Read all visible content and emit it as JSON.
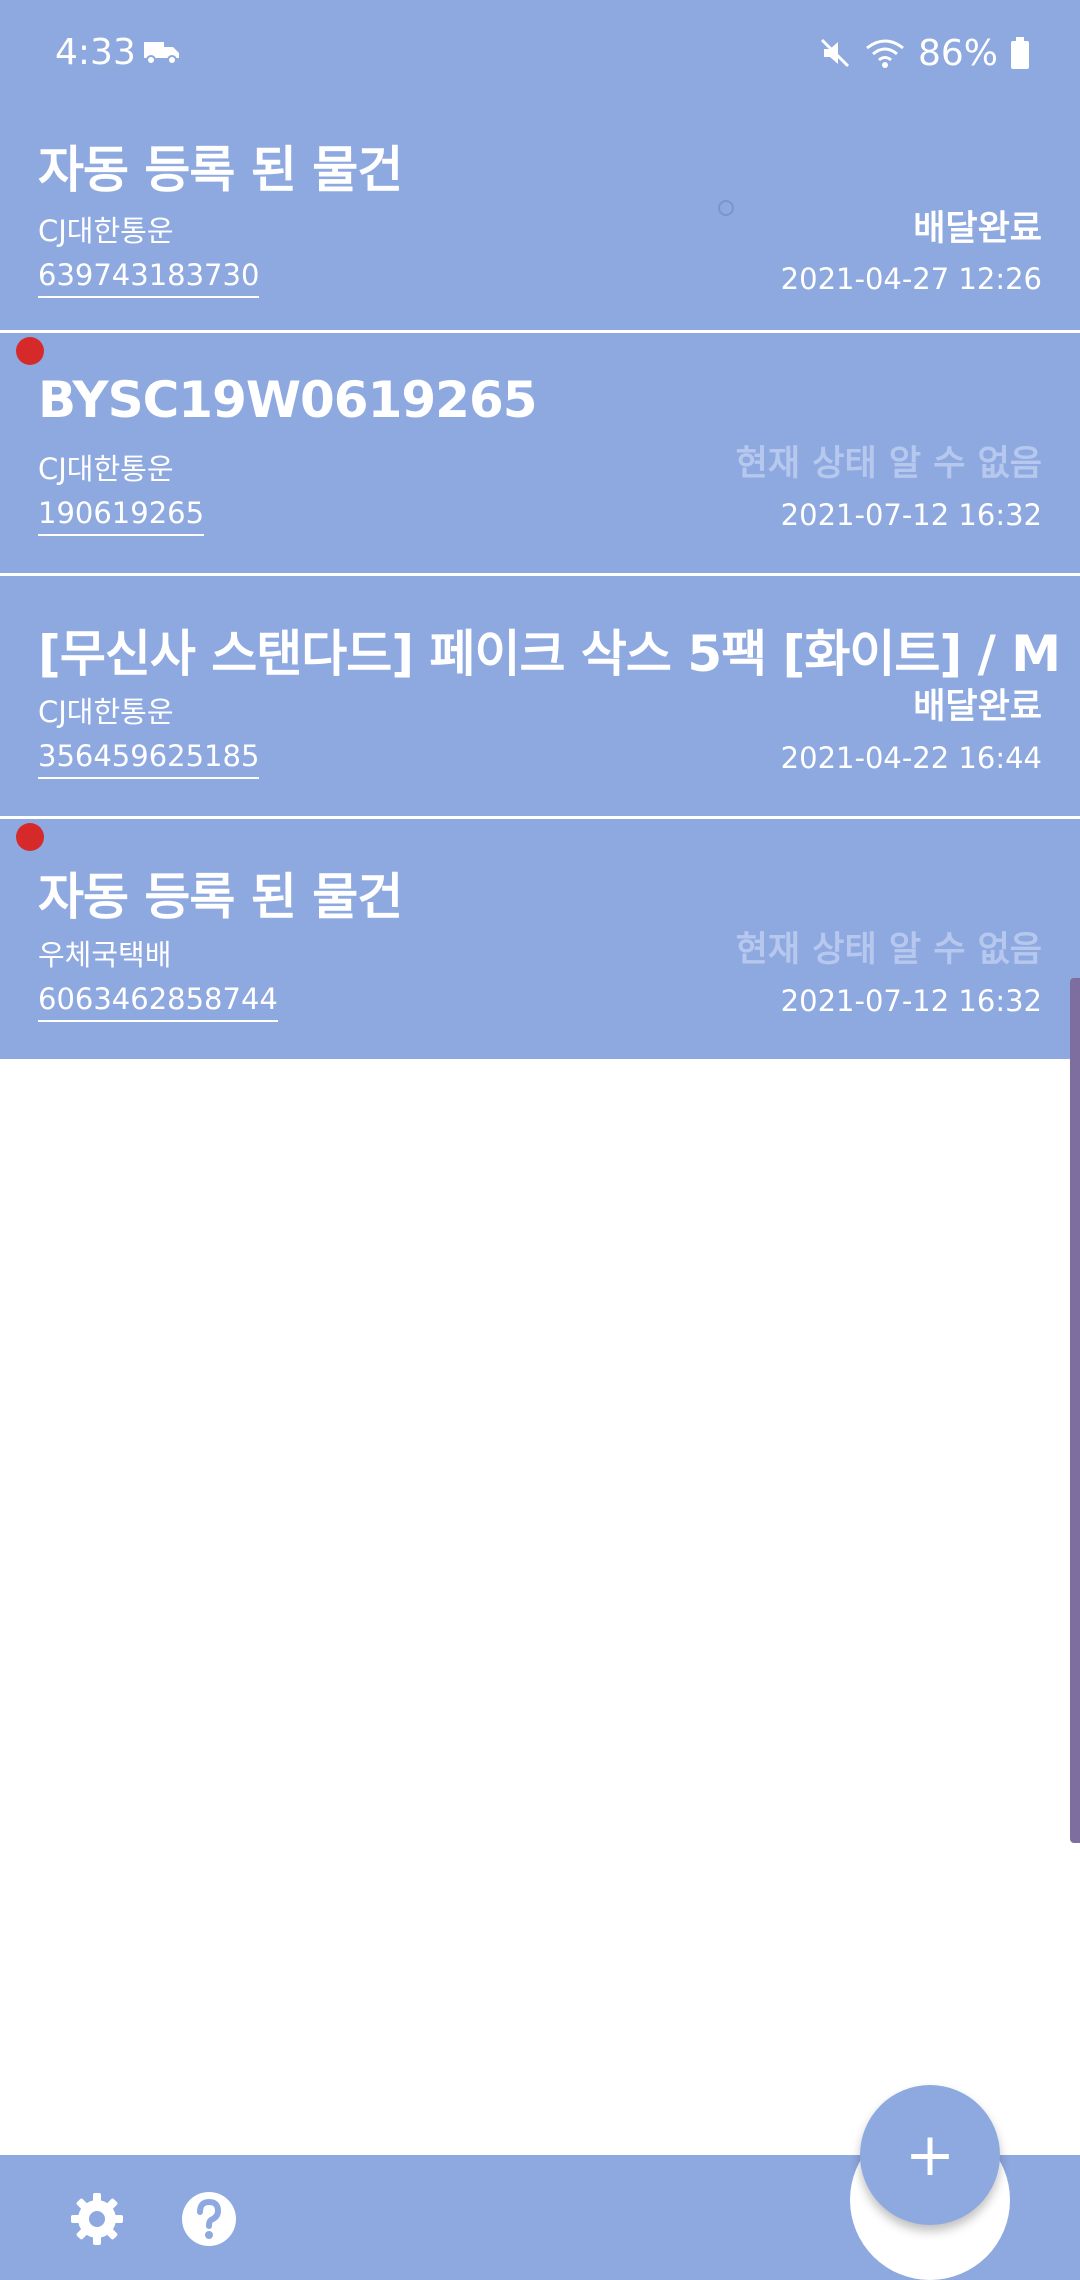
{
  "status_bar": {
    "time": "4:33",
    "battery": "86%",
    "icons": [
      "truck-icon",
      "mute-icon",
      "wifi-icon",
      "battery-icon"
    ]
  },
  "items": [
    {
      "title": "자동 등록 된 물건",
      "carrier": "CJ대한통운",
      "tracking": "639743183730",
      "status": "배달완료",
      "date": "2021-04-27 12:26",
      "unread": false
    },
    {
      "title": "BYSC19W0619265",
      "carrier": "CJ대한통운",
      "tracking": "190619265",
      "status": "현재 상태 알 수 없음",
      "date": "2021-07-12 16:32",
      "unread": true
    },
    {
      "title": "[무신사 스탠다드] 페이크 삭스 5팩 [화이트] / M",
      "carrier": "CJ대한통운",
      "tracking": "356459625185",
      "status": "배달완료",
      "date": "2021-04-22 16:44",
      "unread": false
    },
    {
      "title": "자동 등록 된 물건",
      "carrier": "우체국택배",
      "tracking": "6063462858744",
      "status": "현재 상태 알 수 없음",
      "date": "2021-07-12 16:32",
      "unread": true
    }
  ],
  "fab": {
    "label": "+"
  },
  "colors": {
    "bar": "#8ea8e0",
    "unread_dot": "#d62a2a",
    "unknown_status": "#b7c8ee"
  }
}
